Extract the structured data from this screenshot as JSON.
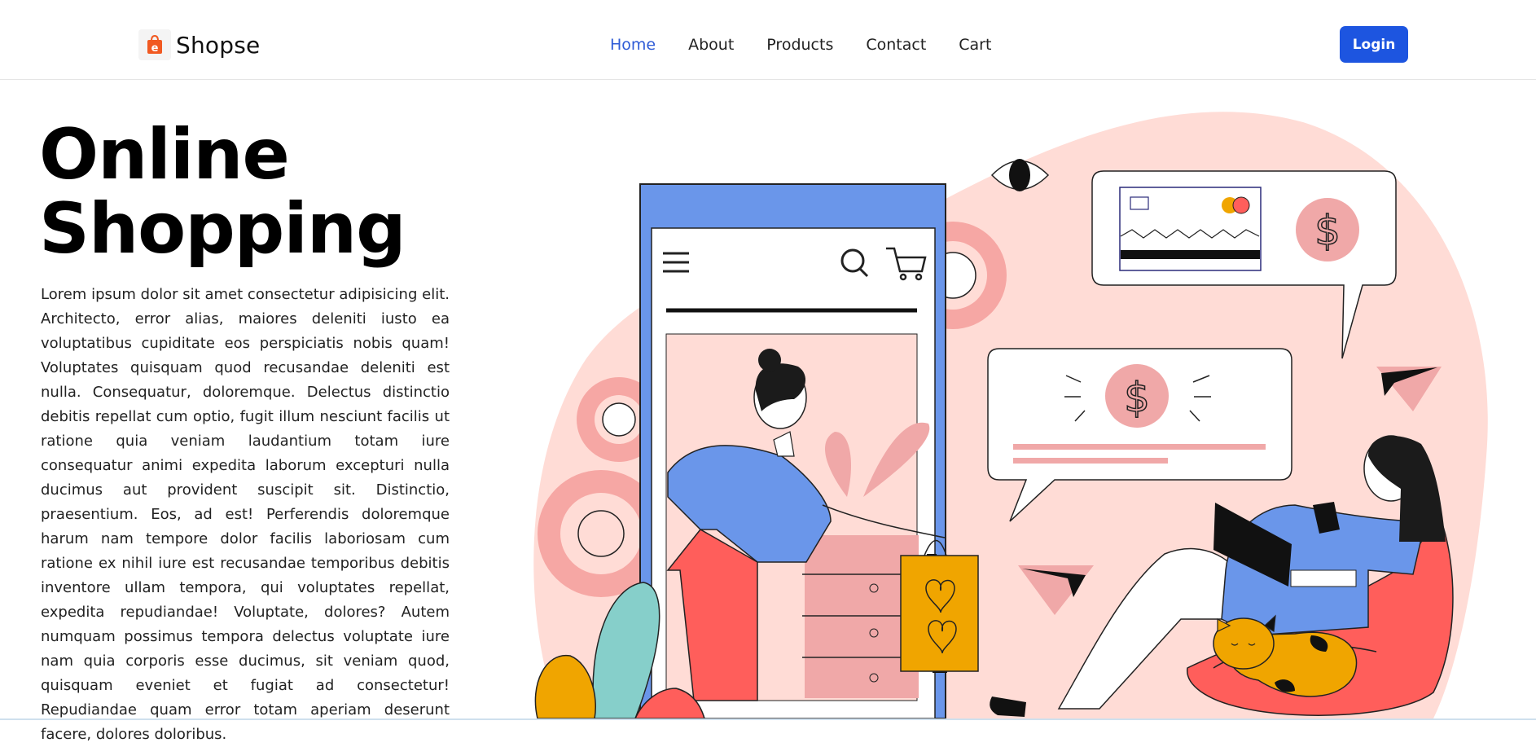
{
  "brand": {
    "name": "Shopse",
    "icon": "shopping-bag-icon",
    "icon_color": "#f15a22"
  },
  "nav": {
    "links": [
      "Home",
      "About",
      "Products",
      "Contact",
      "Cart"
    ],
    "active": "Home",
    "login_label": "Login"
  },
  "hero": {
    "title_line1": "Online",
    "title_line2": "Shopping",
    "body": "Lorem ipsum dolor sit amet consectetur adipisicing elit. Architecto, error alias, maiores deleniti iusto ea voluptatibus cupiditate eos perspiciatis nobis quam! Voluptates quisquam quod recusandae deleniti est nulla. Consequatur, doloremque. Delectus distinctio debitis repellat cum optio, fugit illum nesciunt facilis ut ratione quia veniam laudantium totam iure consequatur animi expedita laborum excepturi nulla ducimus aut provident suscipit sit. Distinctio, praesentium. Eos, ad est! Perferendis doloremque harum nam tempore dolor facilis laboriosam cum ratione ex nihil iure est recusandae temporibus debitis inventore ullam tempora, qui voluptates repellat, expedita repudiandae! Voluptate, dolores? Autem numquam possimus tempora delectus voluptate iure nam quia corporis esse ducimus, sit veniam quod, quisquam eveniet et fugiat ad consectetur! Repudiandae quam error totam aperiam deserunt facere, dolores doloribus."
  },
  "colors": {
    "accent": "#1d55e0",
    "active_link": "#2e5bd6",
    "blob": "#ffdcd6",
    "phone": "#6a96ea",
    "pink": "#f0a8a8",
    "red": "#ff5e5b",
    "yellow": "#f0a500",
    "teal": "#86cfca"
  }
}
